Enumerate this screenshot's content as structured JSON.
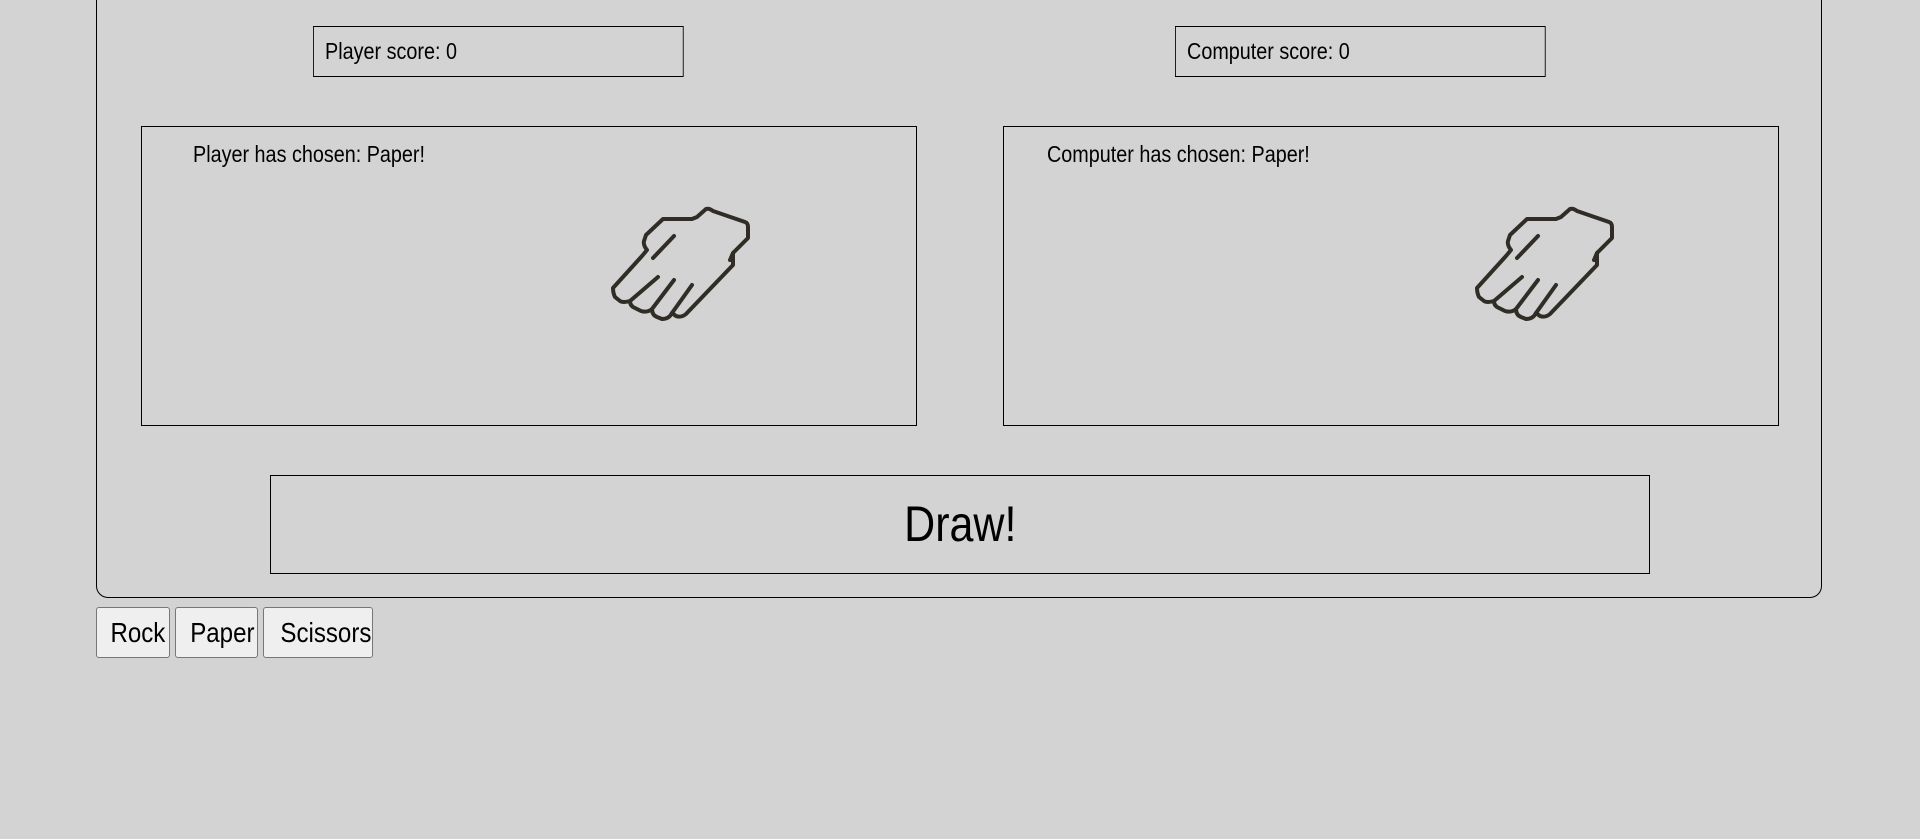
{
  "scores": {
    "player_label": "Player score: 0",
    "computer_label": "Computer score: 0"
  },
  "choices": {
    "player_text": "Player has chosen: Paper!",
    "computer_text": "Computer has chosen: Paper!",
    "player_icon": "paper-hand-icon",
    "computer_icon": "paper-hand-icon"
  },
  "result": {
    "text": "Draw!"
  },
  "controls": {
    "rock_label": "Rock",
    "paper_label": "Paper",
    "scissors_label": "Scissors"
  },
  "colors": {
    "background": "#d3d3d3",
    "icon_stroke": "#2f2d25"
  }
}
